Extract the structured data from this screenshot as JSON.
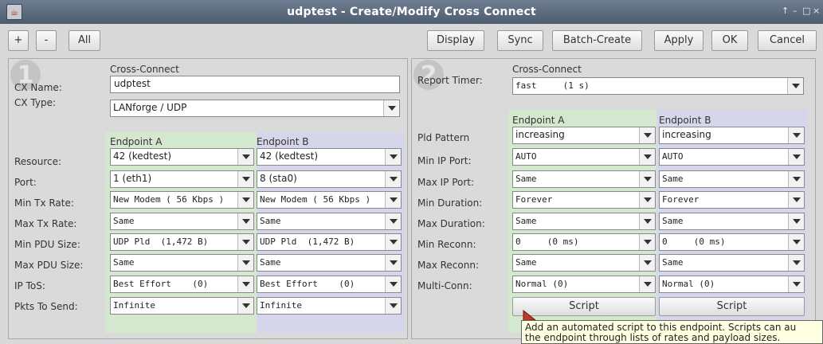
{
  "window": {
    "title": "udptest - Create/Modify Cross Connect",
    "controls": [
      "↑",
      "–",
      "□",
      "×"
    ]
  },
  "toolbar": {
    "plus": "+",
    "minus": "-",
    "all": "All",
    "display": "Display",
    "sync": "Sync",
    "batch_create": "Batch-Create",
    "apply": "Apply",
    "ok": "OK",
    "cancel": "Cancel"
  },
  "panel1": {
    "number": "1",
    "section_title": "Cross-Connect",
    "cx_name_label": "CX Name:",
    "cx_name_value": "udptest",
    "cx_type_label": "CX Type:",
    "cx_type_value": "LANforge / UDP",
    "endpoint_a_header": "Endpoint A",
    "endpoint_b_header": "Endpoint B",
    "rows": [
      {
        "label": "Resource:",
        "a": "42 (kedtest)",
        "b": "42 (kedtest)"
      },
      {
        "label": "Port:",
        "a": "1 (eth1)",
        "b": "8 (sta0)"
      },
      {
        "label": "Min Tx Rate:",
        "a": "New Modem ( 56 Kbps )",
        "b": "New Modem ( 56 Kbps )"
      },
      {
        "label": "Max Tx Rate:",
        "a": "Same",
        "b": "Same"
      },
      {
        "label": "Min PDU Size:",
        "a": "UDP Pld  (1,472 B)",
        "b": "UDP Pld  (1,472 B)"
      },
      {
        "label": "Max PDU Size:",
        "a": "Same",
        "b": "Same"
      },
      {
        "label": "IP ToS:",
        "a": "Best Effort    (0)",
        "b": "Best Effort    (0)"
      },
      {
        "label": "Pkts To Send:",
        "a": "Infinite",
        "b": "Infinite"
      }
    ]
  },
  "panel2": {
    "number": "2",
    "section_title": "Cross-Connect",
    "report_timer_label": "Report Timer:",
    "report_timer_value": "fast     (1 s)",
    "endpoint_a_header": "Endpoint A",
    "endpoint_b_header": "Endpoint B",
    "rows": [
      {
        "label": "Pld Pattern",
        "a": "increasing",
        "b": "increasing"
      },
      {
        "label": "Min IP Port:",
        "a": "AUTO",
        "b": "AUTO"
      },
      {
        "label": "Max IP Port:",
        "a": "Same",
        "b": "Same"
      },
      {
        "label": "Min Duration:",
        "a": "Forever",
        "b": "Forever"
      },
      {
        "label": "Max Duration:",
        "a": "Same",
        "b": "Same"
      },
      {
        "label": "Min Reconn:",
        "a": "0     (0 ms)",
        "b": "0     (0 ms)"
      },
      {
        "label": "Max Reconn:",
        "a": "Same",
        "b": "Same"
      },
      {
        "label": "Multi-Conn:",
        "a": "Normal (0)",
        "b": "Normal (0)"
      }
    ],
    "script_a": "Script",
    "script_b": "Script"
  },
  "tooltip": {
    "line1": "Add an automated script to this endpoint. Scripts can au",
    "line2": "the endpoint through lists of rates and payload sizes."
  }
}
